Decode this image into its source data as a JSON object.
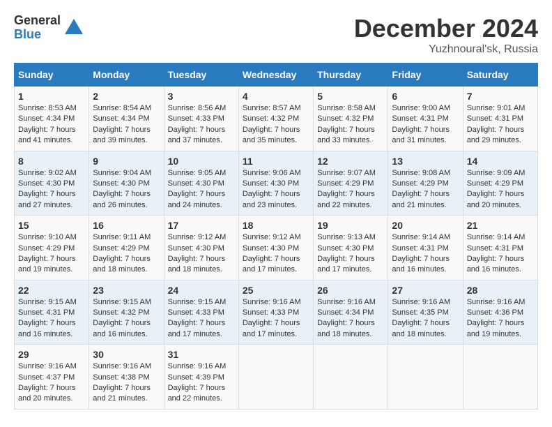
{
  "logo": {
    "general": "General",
    "blue": "Blue"
  },
  "title": "December 2024",
  "location": "Yuzhnoural'sk, Russia",
  "weekdays": [
    "Sunday",
    "Monday",
    "Tuesday",
    "Wednesday",
    "Thursday",
    "Friday",
    "Saturday"
  ],
  "weeks": [
    [
      {
        "day": "1",
        "sunrise": "Sunrise: 8:53 AM",
        "sunset": "Sunset: 4:34 PM",
        "daylight": "Daylight: 7 hours and 41 minutes."
      },
      {
        "day": "2",
        "sunrise": "Sunrise: 8:54 AM",
        "sunset": "Sunset: 4:34 PM",
        "daylight": "Daylight: 7 hours and 39 minutes."
      },
      {
        "day": "3",
        "sunrise": "Sunrise: 8:56 AM",
        "sunset": "Sunset: 4:33 PM",
        "daylight": "Daylight: 7 hours and 37 minutes."
      },
      {
        "day": "4",
        "sunrise": "Sunrise: 8:57 AM",
        "sunset": "Sunset: 4:32 PM",
        "daylight": "Daylight: 7 hours and 35 minutes."
      },
      {
        "day": "5",
        "sunrise": "Sunrise: 8:58 AM",
        "sunset": "Sunset: 4:32 PM",
        "daylight": "Daylight: 7 hours and 33 minutes."
      },
      {
        "day": "6",
        "sunrise": "Sunrise: 9:00 AM",
        "sunset": "Sunset: 4:31 PM",
        "daylight": "Daylight: 7 hours and 31 minutes."
      },
      {
        "day": "7",
        "sunrise": "Sunrise: 9:01 AM",
        "sunset": "Sunset: 4:31 PM",
        "daylight": "Daylight: 7 hours and 29 minutes."
      }
    ],
    [
      {
        "day": "8",
        "sunrise": "Sunrise: 9:02 AM",
        "sunset": "Sunset: 4:30 PM",
        "daylight": "Daylight: 7 hours and 27 minutes."
      },
      {
        "day": "9",
        "sunrise": "Sunrise: 9:04 AM",
        "sunset": "Sunset: 4:30 PM",
        "daylight": "Daylight: 7 hours and 26 minutes."
      },
      {
        "day": "10",
        "sunrise": "Sunrise: 9:05 AM",
        "sunset": "Sunset: 4:30 PM",
        "daylight": "Daylight: 7 hours and 24 minutes."
      },
      {
        "day": "11",
        "sunrise": "Sunrise: 9:06 AM",
        "sunset": "Sunset: 4:30 PM",
        "daylight": "Daylight: 7 hours and 23 minutes."
      },
      {
        "day": "12",
        "sunrise": "Sunrise: 9:07 AM",
        "sunset": "Sunset: 4:29 PM",
        "daylight": "Daylight: 7 hours and 22 minutes."
      },
      {
        "day": "13",
        "sunrise": "Sunrise: 9:08 AM",
        "sunset": "Sunset: 4:29 PM",
        "daylight": "Daylight: 7 hours and 21 minutes."
      },
      {
        "day": "14",
        "sunrise": "Sunrise: 9:09 AM",
        "sunset": "Sunset: 4:29 PM",
        "daylight": "Daylight: 7 hours and 20 minutes."
      }
    ],
    [
      {
        "day": "15",
        "sunrise": "Sunrise: 9:10 AM",
        "sunset": "Sunset: 4:29 PM",
        "daylight": "Daylight: 7 hours and 19 minutes."
      },
      {
        "day": "16",
        "sunrise": "Sunrise: 9:11 AM",
        "sunset": "Sunset: 4:29 PM",
        "daylight": "Daylight: 7 hours and 18 minutes."
      },
      {
        "day": "17",
        "sunrise": "Sunrise: 9:12 AM",
        "sunset": "Sunset: 4:30 PM",
        "daylight": "Daylight: 7 hours and 18 minutes."
      },
      {
        "day": "18",
        "sunrise": "Sunrise: 9:12 AM",
        "sunset": "Sunset: 4:30 PM",
        "daylight": "Daylight: 7 hours and 17 minutes."
      },
      {
        "day": "19",
        "sunrise": "Sunrise: 9:13 AM",
        "sunset": "Sunset: 4:30 PM",
        "daylight": "Daylight: 7 hours and 17 minutes."
      },
      {
        "day": "20",
        "sunrise": "Sunrise: 9:14 AM",
        "sunset": "Sunset: 4:31 PM",
        "daylight": "Daylight: 7 hours and 16 minutes."
      },
      {
        "day": "21",
        "sunrise": "Sunrise: 9:14 AM",
        "sunset": "Sunset: 4:31 PM",
        "daylight": "Daylight: 7 hours and 16 minutes."
      }
    ],
    [
      {
        "day": "22",
        "sunrise": "Sunrise: 9:15 AM",
        "sunset": "Sunset: 4:31 PM",
        "daylight": "Daylight: 7 hours and 16 minutes."
      },
      {
        "day": "23",
        "sunrise": "Sunrise: 9:15 AM",
        "sunset": "Sunset: 4:32 PM",
        "daylight": "Daylight: 7 hours and 16 minutes."
      },
      {
        "day": "24",
        "sunrise": "Sunrise: 9:15 AM",
        "sunset": "Sunset: 4:33 PM",
        "daylight": "Daylight: 7 hours and 17 minutes."
      },
      {
        "day": "25",
        "sunrise": "Sunrise: 9:16 AM",
        "sunset": "Sunset: 4:33 PM",
        "daylight": "Daylight: 7 hours and 17 minutes."
      },
      {
        "day": "26",
        "sunrise": "Sunrise: 9:16 AM",
        "sunset": "Sunset: 4:34 PM",
        "daylight": "Daylight: 7 hours and 18 minutes."
      },
      {
        "day": "27",
        "sunrise": "Sunrise: 9:16 AM",
        "sunset": "Sunset: 4:35 PM",
        "daylight": "Daylight: 7 hours and 18 minutes."
      },
      {
        "day": "28",
        "sunrise": "Sunrise: 9:16 AM",
        "sunset": "Sunset: 4:36 PM",
        "daylight": "Daylight: 7 hours and 19 minutes."
      }
    ],
    [
      {
        "day": "29",
        "sunrise": "Sunrise: 9:16 AM",
        "sunset": "Sunset: 4:37 PM",
        "daylight": "Daylight: 7 hours and 20 minutes."
      },
      {
        "day": "30",
        "sunrise": "Sunrise: 9:16 AM",
        "sunset": "Sunset: 4:38 PM",
        "daylight": "Daylight: 7 hours and 21 minutes."
      },
      {
        "day": "31",
        "sunrise": "Sunrise: 9:16 AM",
        "sunset": "Sunset: 4:39 PM",
        "daylight": "Daylight: 7 hours and 22 minutes."
      },
      {
        "day": "",
        "sunrise": "",
        "sunset": "",
        "daylight": ""
      },
      {
        "day": "",
        "sunrise": "",
        "sunset": "",
        "daylight": ""
      },
      {
        "day": "",
        "sunrise": "",
        "sunset": "",
        "daylight": ""
      },
      {
        "day": "",
        "sunrise": "",
        "sunset": "",
        "daylight": ""
      }
    ]
  ]
}
